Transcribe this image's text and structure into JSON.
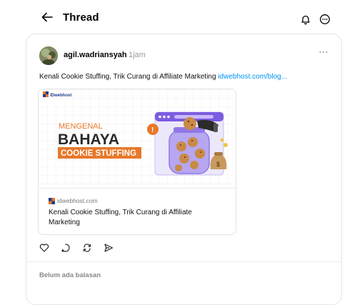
{
  "header": {
    "title": "Thread"
  },
  "post": {
    "username": "agil.wadriansyah",
    "time": "1jam",
    "text": "Kenali Cookie Stuffing, Trik Curang di Affiliate Marketing ",
    "link": "idwebhost.com/blog..."
  },
  "preview": {
    "image_brand": "IDwebhost",
    "image_line1": "MENGENAL",
    "image_line2": "BAHAYA",
    "image_line3": "COOKIE STUFFING",
    "domain": "idwebhost.com",
    "title": "Kenali Cookie Stuffing, Trik Curang di Affiliate Marketing"
  },
  "replies": {
    "empty_label": "Belum ada balasan"
  },
  "colors": {
    "link": "#0095f6",
    "accent_orange": "#e8782a",
    "purple": "#a490e8"
  }
}
